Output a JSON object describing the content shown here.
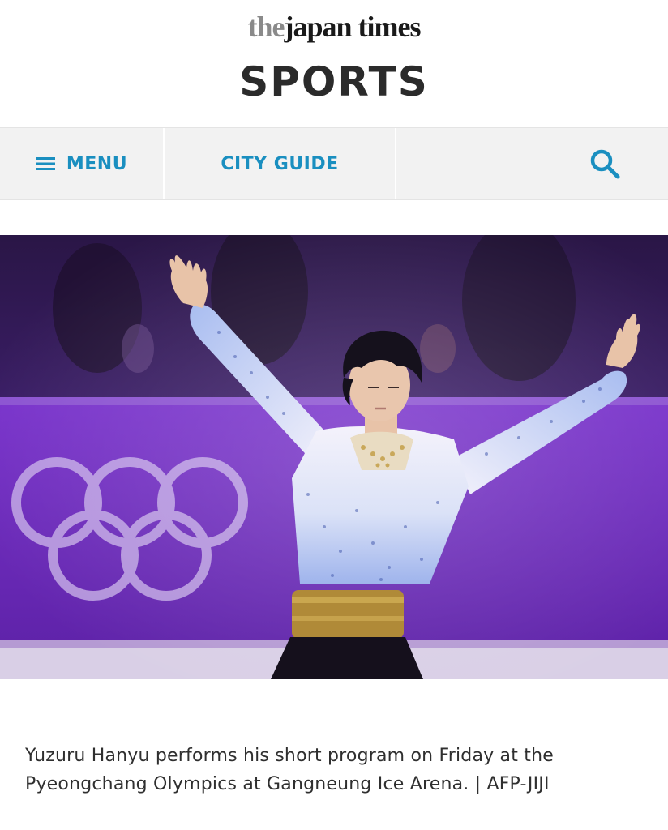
{
  "header": {
    "logo_the": "the",
    "logo_rest": "japan times",
    "section_title": "SPORTS"
  },
  "nav": {
    "menu_label": "MENU",
    "city_guide_label": "CITY GUIDE",
    "menu_icon": "hamburger-icon",
    "search_icon": "search-icon"
  },
  "article": {
    "photo_subject": "figure-skater-photo",
    "caption": "Yuzuru Hanyu performs his short program on Friday at the Pyeongchang Olympics at Gangneung Ice Arena. | AFP-JIJI"
  },
  "colors": {
    "accent": "#1a8fc0",
    "nav_background": "#f2f2f2",
    "rink_purple": "#6b2bb8"
  }
}
